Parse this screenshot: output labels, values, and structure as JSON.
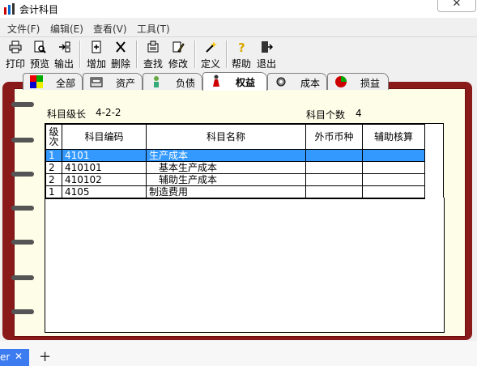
{
  "window": {
    "title": "会计科目",
    "close": "✕"
  },
  "menu": [
    "文件(F)",
    "编辑(E)",
    "查看(V)",
    "工具(T)"
  ],
  "toolbar": {
    "print": "打印",
    "preview": "预览",
    "export": "输出",
    "add": "增加",
    "delete": "删除",
    "find": "查找",
    "modify": "修改",
    "define": "定义",
    "help": "帮助",
    "exit": "退出"
  },
  "tabs": [
    "全部",
    "资产",
    "负债",
    "权益",
    "成本",
    "损益"
  ],
  "info": {
    "level_label": "科目级长",
    "level_value": "4-2-2",
    "count_label": "科目个数",
    "count_value": "4"
  },
  "table": {
    "headers": [
      "级\n次",
      "科目编码",
      "科目名称",
      "外币币种",
      "辅助核算"
    ],
    "rows": [
      [
        "1",
        "4101",
        "生产成本",
        "",
        ""
      ],
      [
        "2",
        "410101",
        "　基本生产成本",
        "",
        ""
      ],
      [
        "2",
        "410102",
        "　辅助生产成本",
        "",
        ""
      ],
      [
        "1",
        "4105",
        "制造费用",
        "",
        ""
      ]
    ]
  },
  "taskbar": {
    "tab": "er",
    "close": "✕",
    "plus": "+"
  },
  "colors": {
    "selection": "#3399ff",
    "binder": "#8a1a1a",
    "paper": "#fefde8"
  }
}
